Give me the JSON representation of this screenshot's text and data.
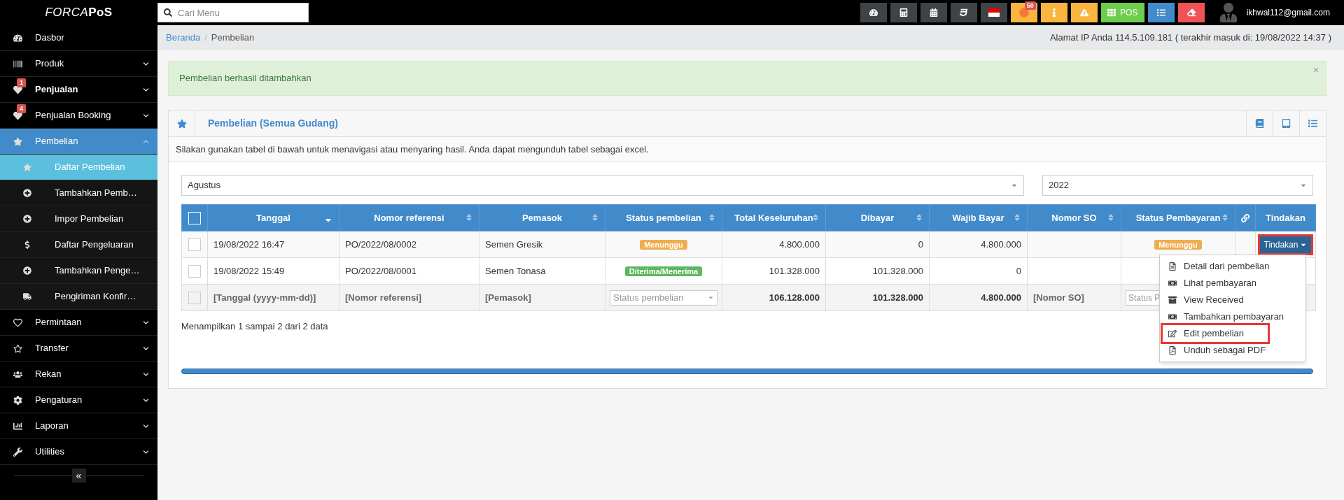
{
  "brand": {
    "logo": "FORCA",
    "logo_bold": "PoS"
  },
  "search": {
    "placeholder": "Cari Menu"
  },
  "top_buttons": [
    {
      "kind": "dashboard"
    },
    {
      "kind": "calculator"
    },
    {
      "kind": "calendar"
    },
    {
      "kind": "css"
    },
    {
      "kind": "flag"
    },
    {
      "kind": "alerts",
      "badge": "50"
    },
    {
      "kind": "info"
    },
    {
      "kind": "warning"
    },
    {
      "kind": "pos",
      "label": "POS"
    },
    {
      "kind": "list"
    },
    {
      "kind": "eraser"
    }
  ],
  "user": {
    "email": "ikhwal112@gmail.com"
  },
  "sidebar": {
    "items": [
      {
        "label": "Dasbor",
        "kind": "dashboard",
        "bold": false,
        "selected": false
      },
      {
        "label": "Produk",
        "kind": "barcode",
        "bold": false,
        "selected": false,
        "expanded": false
      },
      {
        "label": "Penjualan",
        "kind": "heart",
        "badge": "1",
        "bold": true,
        "selected": false,
        "expanded": false
      },
      {
        "label": "Penjualan Booking",
        "kind": "heart",
        "badge": "4",
        "bold": false,
        "selected": false,
        "expanded": false
      },
      {
        "label": "Pembelian",
        "kind": "star",
        "bold": false,
        "selected": true,
        "expanded": true,
        "children": [
          {
            "label": "Daftar Pembelian",
            "kind": "star",
            "selected": true
          },
          {
            "label": "Tambahkan Pemb…",
            "kind": "plus",
            "selected": false
          },
          {
            "label": "Impor Pembelian",
            "kind": "plus",
            "selected": false
          },
          {
            "label": "Daftar Pengeluaran",
            "kind": "dollar",
            "selected": false
          },
          {
            "label": "Tambahkan Penge…",
            "kind": "plus",
            "selected": false
          },
          {
            "label": "Pengiriman Konfir…",
            "kind": "truck",
            "selected": false
          }
        ]
      },
      {
        "label": "Permintaan",
        "kind": "heart-outline",
        "bold": false,
        "selected": false,
        "expanded": false
      },
      {
        "label": "Transfer",
        "kind": "star-outline",
        "bold": false,
        "selected": false,
        "expanded": false
      },
      {
        "label": "Rekan",
        "kind": "users",
        "bold": false,
        "selected": false,
        "expanded": false
      },
      {
        "label": "Pengaturan",
        "kind": "gear",
        "bold": false,
        "selected": false,
        "expanded": false
      },
      {
        "label": "Laporan",
        "kind": "chart",
        "bold": false,
        "selected": false,
        "expanded": false
      },
      {
        "label": "Utilities",
        "kind": "wrench",
        "bold": false,
        "selected": false,
        "expanded": false
      }
    ],
    "collapse_button": "«"
  },
  "breadcrumb": {
    "items": [
      "Beranda",
      "Pembelian"
    ],
    "separator": "/"
  },
  "ip_info": "Alamat IP Anda 114.5.109.181 ( terakhir masuk di: 19/08/2022 14:37 )",
  "alert": {
    "text": "Pembelian berhasil ditambahkan",
    "close": "×"
  },
  "panel": {
    "title": "Pembelian (Semua Gudang)",
    "description": "Silakan gunakan tabel di bawah untuk menavigasi atau menyaring hasil. Anda dapat mengunduh tabel sebagai excel.",
    "filters": [
      {
        "value": "Agustus"
      },
      {
        "value": "2022"
      }
    ],
    "table": {
      "columns": [
        {
          "kind": "checkbox",
          "checked": false
        },
        {
          "label": "Tanggal",
          "kind": "text",
          "sortable": true,
          "sorted": true
        },
        {
          "label": "Nomor referensi",
          "kind": "text",
          "sortable": true,
          "sorted": false
        },
        {
          "label": "Pemasok",
          "kind": "text",
          "sortable": true,
          "sorted": false
        },
        {
          "label": "Status pembelian",
          "kind": "text",
          "sortable": true,
          "sorted": false
        },
        {
          "label": "Total Keseluruhan",
          "kind": "text",
          "sortable": true,
          "sorted": false
        },
        {
          "label": "Dibayar",
          "kind": "text",
          "sortable": true,
          "sorted": false
        },
        {
          "label": "Wajib Bayar",
          "kind": "text",
          "sortable": true,
          "sorted": false
        },
        {
          "label": "Nomor SO",
          "kind": "text",
          "sortable": true,
          "sorted": false
        },
        {
          "label": "Status Pembayaran",
          "kind": "text",
          "sortable": true,
          "sorted": false
        },
        {
          "kind": "link"
        },
        {
          "label": "Tindakan",
          "kind": "text"
        }
      ],
      "rows": [
        {
          "checked": false,
          "date": "19/08/2022 16:47",
          "reference": "PO/2022/08/0002",
          "supplier": "Semen Gresik",
          "status": {
            "text": "Menunggu",
            "kind": "pending"
          },
          "total": "4.800.000",
          "paid": "0",
          "due": "4.800.000",
          "payment_status": {
            "text": "Menunggu",
            "kind": "pending"
          },
          "action": {
            "label": "Tindakan",
            "highlighted": true,
            "expanded": true
          }
        },
        {
          "checked": false,
          "date": "19/08/2022 15:49",
          "reference": "PO/2022/08/0001",
          "supplier": "Semen Tonasa",
          "status": {
            "text": "Diterima/Menerima",
            "kind": "received"
          },
          "total": "101.328.000",
          "paid": "101.328.000",
          "due": "0"
        }
      ],
      "footer": {
        "checked": false,
        "date": "[Tanggal (yyyy-mm-dd)]",
        "reference": "[Nomor referensi]",
        "supplier": "[Pemasok]",
        "status_placeholder": "Status pembelian",
        "total": "106.128.000",
        "paid": "101.328.000",
        "due": "4.800.000",
        "so": "[Nomor SO]",
        "payment_placeholder": "Status P"
      },
      "info": "Menampilkan 1 sampai 2 dari 2 data"
    },
    "action_menu": [
      {
        "label": "Detail dari pembelian",
        "kind": "file",
        "highlighted": false
      },
      {
        "label": "Lihat pembayaran",
        "kind": "money",
        "highlighted": false
      },
      {
        "label": "View Received",
        "kind": "archive",
        "highlighted": false
      },
      {
        "label": "Tambahkan pembayaran",
        "kind": "money",
        "highlighted": false
      },
      {
        "label": "Edit pembelian",
        "kind": "edit",
        "highlighted": true
      },
      {
        "label": "Unduh sebagai PDF",
        "kind": "pdf",
        "highlighted": false
      }
    ]
  }
}
